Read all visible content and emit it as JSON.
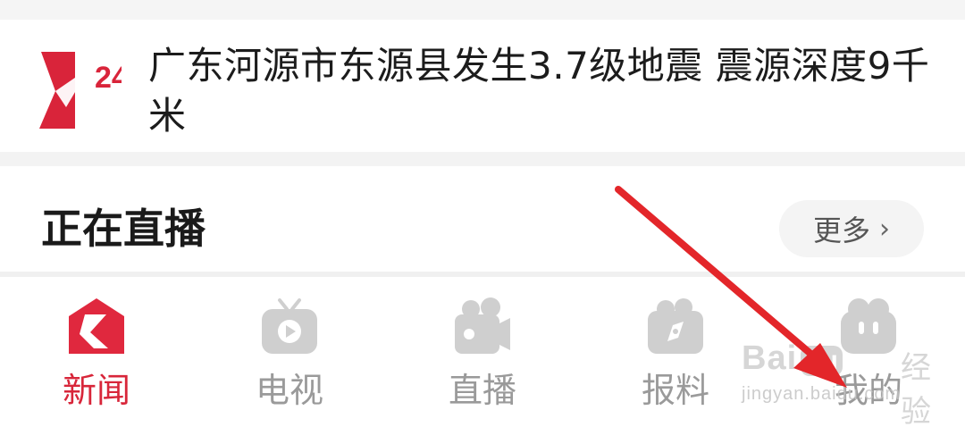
{
  "news": {
    "logo_text": "24",
    "title": "广东河源市东源县发生3.7级地震 震源深度9千米"
  },
  "live": {
    "title": "正在直播",
    "more_label": "更多",
    "more_chevron": "›"
  },
  "tabs": [
    {
      "label": "新闻",
      "icon": "news-home-icon",
      "active": true
    },
    {
      "label": "电视",
      "icon": "tv-icon",
      "active": false
    },
    {
      "label": "直播",
      "icon": "live-camera-icon",
      "active": false
    },
    {
      "label": "报料",
      "icon": "report-compass-icon",
      "active": false
    },
    {
      "label": "我的",
      "icon": "profile-icon",
      "active": false
    }
  ],
  "watermark": {
    "brand_prefix": "Bai",
    "brand_badge": "du",
    "brand_cn": "经验",
    "url": "jingyan.baidu.com"
  },
  "colors": {
    "accent": "#d8263a",
    "inactive": "#9a9a9a",
    "annotation_arrow": "#e3262a"
  }
}
